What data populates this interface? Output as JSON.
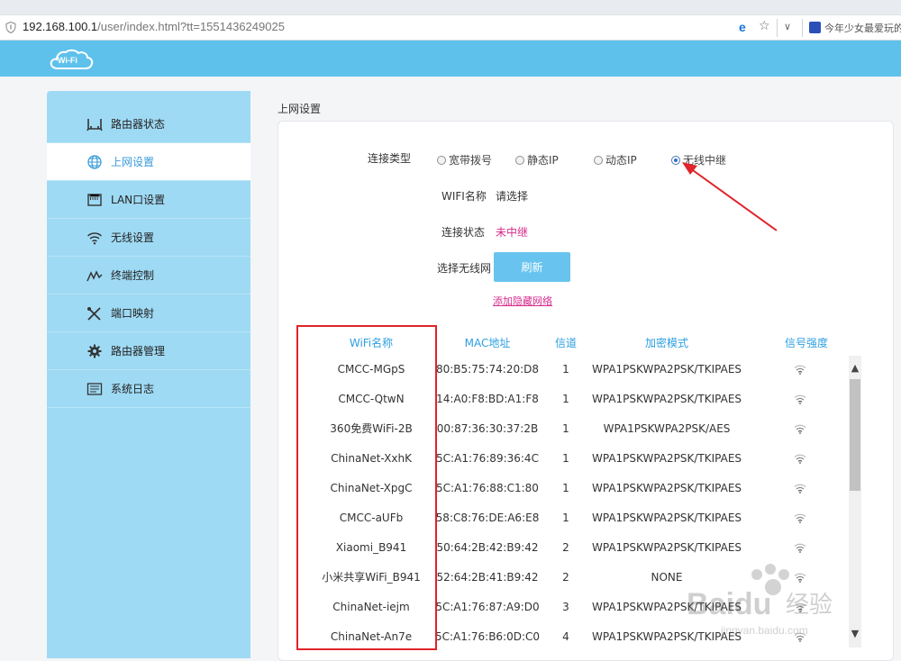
{
  "browser": {
    "url_host": "192.168.100.1",
    "url_path": "/user/index.html?tt=1551436249025",
    "bookmark_text": "今年少女最爱玩的",
    "shield_icon": "shield-icon",
    "ie_icon": "ie-logo-icon",
    "star_icon": "star-icon",
    "chevron_icon": "chevron-down-icon"
  },
  "header": {
    "logo_text": "Wi-Fi"
  },
  "sidebar": {
    "items": [
      {
        "label": "路由器状态",
        "icon": "router-icon",
        "active": false
      },
      {
        "label": "上网设置",
        "icon": "globe-icon",
        "active": true
      },
      {
        "label": "LAN口设置",
        "icon": "lan-port-icon",
        "active": false
      },
      {
        "label": "无线设置",
        "icon": "wifi-icon",
        "active": false
      },
      {
        "label": "终端控制",
        "icon": "chart-wave-icon",
        "active": false
      },
      {
        "label": "端口映射",
        "icon": "tools-icon",
        "active": false
      },
      {
        "label": "路由器管理",
        "icon": "gear-icon",
        "active": false
      },
      {
        "label": "系统日志",
        "icon": "log-icon",
        "active": false
      }
    ]
  },
  "main": {
    "title": "上网设置",
    "connection_type_label": "连接类型",
    "connection_types": [
      {
        "label": "宽带拨号",
        "checked": false
      },
      {
        "label": "静态IP",
        "checked": false
      },
      {
        "label": "动态IP",
        "checked": false
      },
      {
        "label": "无线中继",
        "checked": true
      }
    ],
    "wifi_name_label": "WIFI名称",
    "wifi_name_value": "请选择",
    "status_label": "连接状态",
    "status_value": "未中继",
    "select_network_label": "选择无线网",
    "refresh_label": "刷新",
    "add_hidden_label": "添加隐藏网络"
  },
  "table": {
    "headers": [
      "WiFi名称",
      "MAC地址",
      "信道",
      "加密模式",
      "信号强度"
    ],
    "rows": [
      {
        "ssid": "CMCC-MGpS",
        "mac": "80:B5:75:74:20:D8",
        "channel": "1",
        "encryption": "WPA1PSKWPA2PSK/TKIPAES"
      },
      {
        "ssid": "CMCC-QtwN",
        "mac": "14:A0:F8:BD:A1:F8",
        "channel": "1",
        "encryption": "WPA1PSKWPA2PSK/TKIPAES"
      },
      {
        "ssid": "360免费WiFi-2B",
        "mac": "00:87:36:30:37:2B",
        "channel": "1",
        "encryption": "WPA1PSKWPA2PSK/AES"
      },
      {
        "ssid": "ChinaNet-XxhK",
        "mac": "5C:A1:76:89:36:4C",
        "channel": "1",
        "encryption": "WPA1PSKWPA2PSK/TKIPAES"
      },
      {
        "ssid": "ChinaNet-XpgC",
        "mac": "5C:A1:76:88:C1:80",
        "channel": "1",
        "encryption": "WPA1PSKWPA2PSK/TKIPAES"
      },
      {
        "ssid": "CMCC-aUFb",
        "mac": "58:C8:76:DE:A6:E8",
        "channel": "1",
        "encryption": "WPA1PSKWPA2PSK/TKIPAES"
      },
      {
        "ssid": "Xiaomi_B941",
        "mac": "50:64:2B:42:B9:42",
        "channel": "2",
        "encryption": "WPA1PSKWPA2PSK/TKIPAES"
      },
      {
        "ssid": "小米共享WiFi_B941",
        "mac": "52:64:2B:41:B9:42",
        "channel": "2",
        "encryption": "NONE"
      },
      {
        "ssid": "ChinaNet-iejm",
        "mac": "5C:A1:76:87:A9:D0",
        "channel": "3",
        "encryption": "WPA1PSKWPA2PSK/TKIPAES"
      },
      {
        "ssid": "ChinaNet-An7e",
        "mac": "5C:A1:76:B6:0D:C0",
        "channel": "4",
        "encryption": "WPA1PSKWPA2PSK/TKIPAES"
      }
    ]
  },
  "watermark": {
    "brand": "Baidu",
    "word": "经验",
    "url": "jingyan.baidu.com"
  },
  "colors": {
    "header": "#5ec1ec",
    "sidebar": "#9fdaf4",
    "accent": "#2e9fe0",
    "status": "#d72a8e",
    "annotation": "#e0242a"
  }
}
